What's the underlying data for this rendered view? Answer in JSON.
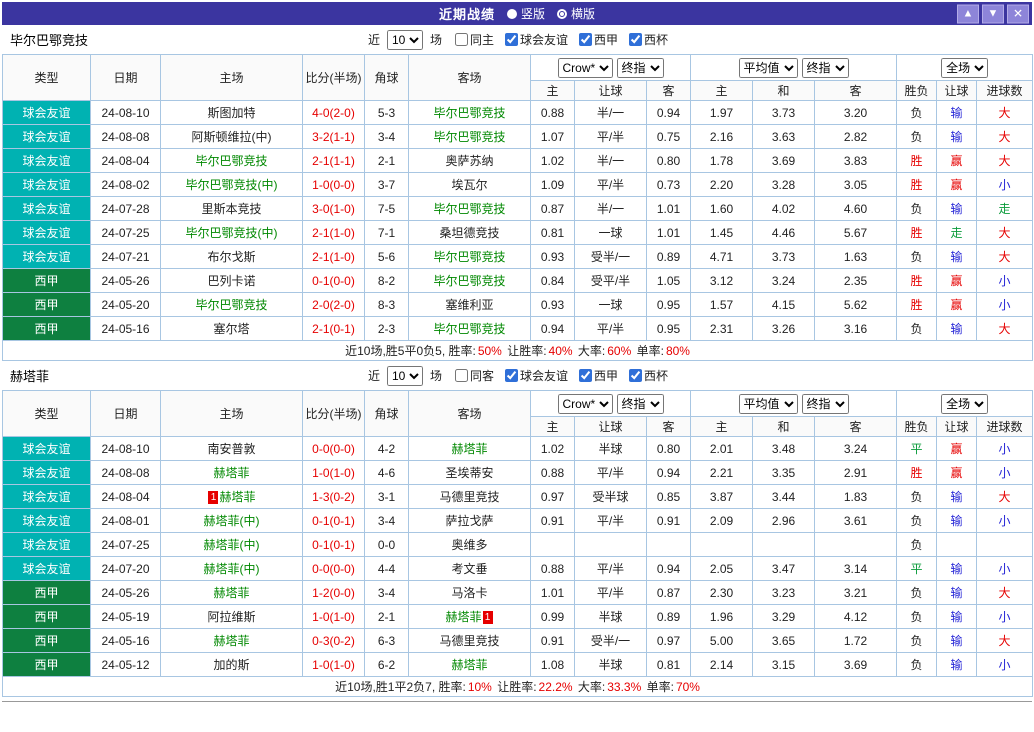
{
  "topbar": {
    "title": "近期战绩",
    "radios": [
      {
        "label": "竖版",
        "checked": false
      },
      {
        "label": "横版",
        "checked": true
      }
    ],
    "buttons": {
      "up": "▲",
      "down": "▼",
      "close": "✕"
    }
  },
  "colors": {
    "topbar_bg": "#3b35a0",
    "button_bg": "#8d85d9",
    "friendly_bg": "#00b2b2",
    "league_bg": "#0e8040",
    "win": "#e60000",
    "lose": "#2323d6",
    "draw": "#0a9b3a",
    "team": "#008800",
    "score": "#e60000",
    "border": "#a8c6e2",
    "checkbox": "#2f6fd8"
  },
  "tables": [
    {
      "team": "毕尔巴鄂竞技",
      "filters": {
        "near": "近",
        "count": "10",
        "games": "场",
        "options": [
          {
            "key": "same-home",
            "label": "同主",
            "checked": false
          },
          {
            "key": "friendly",
            "label": "球会友谊",
            "checked": true
          },
          {
            "key": "laliga",
            "label": "西甲",
            "checked": true
          },
          {
            "key": "copa",
            "label": "西杯",
            "checked": true
          }
        ]
      },
      "columns": [
        "类型",
        "日期",
        "主场",
        "比分(半场)",
        "角球",
        "客场"
      ],
      "odds1_selects": [
        "Crow*",
        "终指"
      ],
      "odds1_cols": [
        "主",
        "让球",
        "客"
      ],
      "odds2_selects": [
        "平均值",
        "终指"
      ],
      "odds2_cols": [
        "主",
        "和",
        "客"
      ],
      "result_select": "全场",
      "result_cols": [
        "胜负",
        "让球",
        "进球数"
      ],
      "rows": [
        {
          "type": "球会友谊",
          "league_type": "friendly",
          "date": "24-08-10",
          "home": {
            "text": "斯图加特",
            "team": false
          },
          "score": "4-0(2-0)",
          "corner": "5-3",
          "away": {
            "text": "毕尔巴鄂竞技",
            "team": true
          },
          "odds": [
            "0.88",
            "半/一",
            "0.94"
          ],
          "avg": [
            "1.97",
            "3.73",
            "3.20"
          ],
          "results": [
            {
              "t": "负",
              "c": "black"
            },
            {
              "t": "输",
              "c": "blue"
            },
            {
              "t": "大",
              "c": "red"
            }
          ]
        },
        {
          "type": "球会友谊",
          "league_type": "friendly",
          "date": "24-08-08",
          "home": {
            "text": "阿斯顿维拉(中)",
            "team": false
          },
          "score": "3-2(1-1)",
          "corner": "3-4",
          "away": {
            "text": "毕尔巴鄂竞技",
            "team": true
          },
          "odds": [
            "1.07",
            "平/半",
            "0.75"
          ],
          "avg": [
            "2.16",
            "3.63",
            "2.82"
          ],
          "results": [
            {
              "t": "负",
              "c": "black"
            },
            {
              "t": "输",
              "c": "blue"
            },
            {
              "t": "大",
              "c": "red"
            }
          ]
        },
        {
          "type": "球会友谊",
          "league_type": "friendly",
          "date": "24-08-04",
          "home": {
            "text": "毕尔巴鄂竞技",
            "team": true
          },
          "score": "2-1(1-1)",
          "corner": "2-1",
          "away": {
            "text": "奥萨苏纳",
            "team": false
          },
          "odds": [
            "1.02",
            "半/一",
            "0.80"
          ],
          "avg": [
            "1.78",
            "3.69",
            "3.83"
          ],
          "results": [
            {
              "t": "胜",
              "c": "red"
            },
            {
              "t": "赢",
              "c": "red"
            },
            {
              "t": "大",
              "c": "red"
            }
          ]
        },
        {
          "type": "球会友谊",
          "league_type": "friendly",
          "date": "24-08-02",
          "home": {
            "text": "毕尔巴鄂竞技(中)",
            "team": true
          },
          "score": "1-0(0-0)",
          "corner": "3-7",
          "away": {
            "text": "埃瓦尔",
            "team": false
          },
          "odds": [
            "1.09",
            "平/半",
            "0.73"
          ],
          "avg": [
            "2.20",
            "3.28",
            "3.05"
          ],
          "results": [
            {
              "t": "胜",
              "c": "red"
            },
            {
              "t": "赢",
              "c": "red"
            },
            {
              "t": "小",
              "c": "blue"
            }
          ]
        },
        {
          "type": "球会友谊",
          "league_type": "friendly",
          "date": "24-07-28",
          "home": {
            "text": "里斯本竞技",
            "team": false
          },
          "score": "3-0(1-0)",
          "corner": "7-5",
          "away": {
            "text": "毕尔巴鄂竞技",
            "team": true
          },
          "odds": [
            "0.87",
            "半/一",
            "1.01"
          ],
          "avg": [
            "1.60",
            "4.02",
            "4.60"
          ],
          "results": [
            {
              "t": "负",
              "c": "black"
            },
            {
              "t": "输",
              "c": "blue"
            },
            {
              "t": "走",
              "c": "green"
            }
          ]
        },
        {
          "type": "球会友谊",
          "league_type": "friendly",
          "date": "24-07-25",
          "home": {
            "text": "毕尔巴鄂竞技(中)",
            "team": true
          },
          "score": "2-1(1-0)",
          "corner": "7-1",
          "away": {
            "text": "桑坦德竞技",
            "team": false
          },
          "odds": [
            "0.81",
            "一球",
            "1.01"
          ],
          "avg": [
            "1.45",
            "4.46",
            "5.67"
          ],
          "results": [
            {
              "t": "胜",
              "c": "red"
            },
            {
              "t": "走",
              "c": "green"
            },
            {
              "t": "大",
              "c": "red"
            }
          ]
        },
        {
          "type": "球会友谊",
          "league_type": "friendly",
          "date": "24-07-21",
          "home": {
            "text": "布尔戈斯",
            "team": false
          },
          "score": "2-1(1-0)",
          "corner": "5-6",
          "away": {
            "text": "毕尔巴鄂竞技",
            "team": true
          },
          "odds": [
            "0.93",
            "受半/一",
            "0.89"
          ],
          "avg": [
            "4.71",
            "3.73",
            "1.63"
          ],
          "results": [
            {
              "t": "负",
              "c": "black"
            },
            {
              "t": "输",
              "c": "blue"
            },
            {
              "t": "大",
              "c": "red"
            }
          ]
        },
        {
          "type": "西甲",
          "league_type": "league",
          "date": "24-05-26",
          "home": {
            "text": "巴列卡诺",
            "team": false
          },
          "score": "0-1(0-0)",
          "corner": "8-2",
          "away": {
            "text": "毕尔巴鄂竞技",
            "team": true
          },
          "odds": [
            "0.84",
            "受平/半",
            "1.05"
          ],
          "avg": [
            "3.12",
            "3.24",
            "2.35"
          ],
          "results": [
            {
              "t": "胜",
              "c": "red"
            },
            {
              "t": "赢",
              "c": "red"
            },
            {
              "t": "小",
              "c": "blue"
            }
          ]
        },
        {
          "type": "西甲",
          "league_type": "league",
          "date": "24-05-20",
          "home": {
            "text": "毕尔巴鄂竞技",
            "team": true
          },
          "score": "2-0(2-0)",
          "corner": "8-3",
          "away": {
            "text": "塞维利亚",
            "team": false
          },
          "odds": [
            "0.93",
            "一球",
            "0.95"
          ],
          "avg": [
            "1.57",
            "4.15",
            "5.62"
          ],
          "results": [
            {
              "t": "胜",
              "c": "red"
            },
            {
              "t": "赢",
              "c": "red"
            },
            {
              "t": "小",
              "c": "blue"
            }
          ]
        },
        {
          "type": "西甲",
          "league_type": "league",
          "date": "24-05-16",
          "home": {
            "text": "塞尔塔",
            "team": false
          },
          "score": "2-1(0-1)",
          "corner": "2-3",
          "away": {
            "text": "毕尔巴鄂竞技",
            "team": true
          },
          "odds": [
            "0.94",
            "平/半",
            "0.95"
          ],
          "avg": [
            "2.31",
            "3.26",
            "3.16"
          ],
          "results": [
            {
              "t": "负",
              "c": "black"
            },
            {
              "t": "输",
              "c": "blue"
            },
            {
              "t": "大",
              "c": "red"
            }
          ]
        }
      ],
      "footer": [
        [
          "近10场,胜5平0负5, 胜率:",
          "k"
        ],
        [
          "50%",
          "r"
        ],
        [
          " 让胜率:",
          "k"
        ],
        [
          "40%",
          "r"
        ],
        [
          " 大率:",
          "k"
        ],
        [
          "60%",
          "r"
        ],
        [
          " 单率:",
          "k"
        ],
        [
          "80%",
          "r"
        ]
      ]
    },
    {
      "team": "赫塔菲",
      "filters": {
        "near": "近",
        "count": "10",
        "games": "场",
        "options": [
          {
            "key": "same-home",
            "label": "同客",
            "checked": false
          },
          {
            "key": "friendly",
            "label": "球会友谊",
            "checked": true
          },
          {
            "key": "laliga",
            "label": "西甲",
            "checked": true
          },
          {
            "key": "copa",
            "label": "西杯",
            "checked": true
          }
        ]
      },
      "columns": [
        "类型",
        "日期",
        "主场",
        "比分(半场)",
        "角球",
        "客场"
      ],
      "odds1_selects": [
        "Crow*",
        "终指"
      ],
      "odds1_cols": [
        "主",
        "让球",
        "客"
      ],
      "odds2_selects": [
        "平均值",
        "终指"
      ],
      "odds2_cols": [
        "主",
        "和",
        "客"
      ],
      "result_select": "全场",
      "result_cols": [
        "胜负",
        "让球",
        "进球数"
      ],
      "rows": [
        {
          "type": "球会友谊",
          "league_type": "friendly",
          "date": "24-08-10",
          "home": {
            "text": "南安普敦",
            "team": false
          },
          "score": "0-0(0-0)",
          "corner": "4-2",
          "away": {
            "text": "赫塔菲",
            "team": true
          },
          "odds": [
            "1.02",
            "半球",
            "0.80"
          ],
          "avg": [
            "2.01",
            "3.48",
            "3.24"
          ],
          "results": [
            {
              "t": "平",
              "c": "green"
            },
            {
              "t": "赢",
              "c": "red"
            },
            {
              "t": "小",
              "c": "blue"
            }
          ]
        },
        {
          "type": "球会友谊",
          "league_type": "friendly",
          "date": "24-08-08",
          "home": {
            "text": "赫塔菲",
            "team": true
          },
          "score": "1-0(1-0)",
          "corner": "4-6",
          "away": {
            "text": "圣埃蒂安",
            "team": false
          },
          "odds": [
            "0.88",
            "平/半",
            "0.94"
          ],
          "avg": [
            "2.21",
            "3.35",
            "2.91"
          ],
          "results": [
            {
              "t": "胜",
              "c": "red"
            },
            {
              "t": "赢",
              "c": "red"
            },
            {
              "t": "小",
              "c": "blue"
            }
          ]
        },
        {
          "type": "球会友谊",
          "league_type": "friendly",
          "date": "24-08-04",
          "home": {
            "text": "赫塔菲",
            "team": true,
            "card": "1",
            "card_pos": "before"
          },
          "score": "1-3(0-2)",
          "corner": "3-1",
          "away": {
            "text": "马德里竞技",
            "team": false
          },
          "odds": [
            "0.97",
            "受半球",
            "0.85"
          ],
          "avg": [
            "3.87",
            "3.44",
            "1.83"
          ],
          "results": [
            {
              "t": "负",
              "c": "black"
            },
            {
              "t": "输",
              "c": "blue"
            },
            {
              "t": "大",
              "c": "red"
            }
          ]
        },
        {
          "type": "球会友谊",
          "league_type": "friendly",
          "date": "24-08-01",
          "home": {
            "text": "赫塔菲(中)",
            "team": true
          },
          "score": "0-1(0-1)",
          "corner": "3-4",
          "away": {
            "text": "萨拉戈萨",
            "team": false
          },
          "odds": [
            "0.91",
            "平/半",
            "0.91"
          ],
          "avg": [
            "2.09",
            "2.96",
            "3.61"
          ],
          "results": [
            {
              "t": "负",
              "c": "black"
            },
            {
              "t": "输",
              "c": "blue"
            },
            {
              "t": "小",
              "c": "blue"
            }
          ]
        },
        {
          "type": "球会友谊",
          "league_type": "friendly",
          "date": "24-07-25",
          "home": {
            "text": "赫塔菲(中)",
            "team": true
          },
          "score": "0-1(0-1)",
          "corner": "0-0",
          "away": {
            "text": "奥维多",
            "team": false
          },
          "odds": [
            "",
            "",
            ""
          ],
          "avg": [
            "",
            "",
            ""
          ],
          "results": [
            {
              "t": "负",
              "c": "black"
            },
            {
              "t": "",
              "c": "black"
            },
            {
              "t": "",
              "c": "black"
            }
          ]
        },
        {
          "type": "球会友谊",
          "league_type": "friendly",
          "date": "24-07-20",
          "home": {
            "text": "赫塔菲(中)",
            "team": true
          },
          "score": "0-0(0-0)",
          "corner": "4-4",
          "away": {
            "text": "考文垂",
            "team": false
          },
          "odds": [
            "0.88",
            "平/半",
            "0.94"
          ],
          "avg": [
            "2.05",
            "3.47",
            "3.14"
          ],
          "results": [
            {
              "t": "平",
              "c": "green"
            },
            {
              "t": "输",
              "c": "blue"
            },
            {
              "t": "小",
              "c": "blue"
            }
          ]
        },
        {
          "type": "西甲",
          "league_type": "league",
          "date": "24-05-26",
          "home": {
            "text": "赫塔菲",
            "team": true
          },
          "score": "1-2(0-0)",
          "corner": "3-4",
          "away": {
            "text": "马洛卡",
            "team": false
          },
          "odds": [
            "1.01",
            "平/半",
            "0.87"
          ],
          "avg": [
            "2.30",
            "3.23",
            "3.21"
          ],
          "results": [
            {
              "t": "负",
              "c": "black"
            },
            {
              "t": "输",
              "c": "blue"
            },
            {
              "t": "大",
              "c": "red"
            }
          ]
        },
        {
          "type": "西甲",
          "league_type": "league",
          "date": "24-05-19",
          "home": {
            "text": "阿拉维斯",
            "team": false
          },
          "score": "1-0(1-0)",
          "corner": "2-1",
          "away": {
            "text": "赫塔菲",
            "team": true,
            "card": "1",
            "card_pos": "after"
          },
          "odds": [
            "0.99",
            "半球",
            "0.89"
          ],
          "avg": [
            "1.96",
            "3.29",
            "4.12"
          ],
          "results": [
            {
              "t": "负",
              "c": "black"
            },
            {
              "t": "输",
              "c": "blue"
            },
            {
              "t": "小",
              "c": "blue"
            }
          ]
        },
        {
          "type": "西甲",
          "league_type": "league",
          "date": "24-05-16",
          "home": {
            "text": "赫塔菲",
            "team": true
          },
          "score": "0-3(0-2)",
          "corner": "6-3",
          "away": {
            "text": "马德里竞技",
            "team": false
          },
          "odds": [
            "0.91",
            "受半/一",
            "0.97"
          ],
          "avg": [
            "5.00",
            "3.65",
            "1.72"
          ],
          "results": [
            {
              "t": "负",
              "c": "black"
            },
            {
              "t": "输",
              "c": "blue"
            },
            {
              "t": "大",
              "c": "red"
            }
          ]
        },
        {
          "type": "西甲",
          "league_type": "league",
          "date": "24-05-12",
          "home": {
            "text": "加的斯",
            "team": false
          },
          "score": "1-0(1-0)",
          "corner": "6-2",
          "away": {
            "text": "赫塔菲",
            "team": true
          },
          "odds": [
            "1.08",
            "半球",
            "0.81"
          ],
          "avg": [
            "2.14",
            "3.15",
            "3.69"
          ],
          "results": [
            {
              "t": "负",
              "c": "black"
            },
            {
              "t": "输",
              "c": "blue"
            },
            {
              "t": "小",
              "c": "blue"
            }
          ]
        }
      ],
      "footer": [
        [
          "近10场,胜1平2负7, 胜率:",
          "k"
        ],
        [
          "10%",
          "r"
        ],
        [
          " 让胜率:",
          "k"
        ],
        [
          "22.2%",
          "r"
        ],
        [
          " 大率:",
          "k"
        ],
        [
          "33.3%",
          "r"
        ],
        [
          " 单率:",
          "k"
        ],
        [
          "70%",
          "r"
        ]
      ]
    }
  ]
}
